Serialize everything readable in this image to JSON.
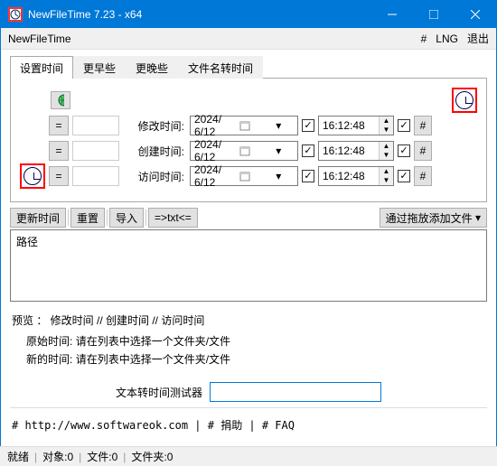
{
  "window": {
    "title": "NewFileTime 7.23 - x64"
  },
  "menubar": {
    "appname": "NewFileTime",
    "hash": "#",
    "lng": "LNG",
    "exit": "退出"
  },
  "tabs": {
    "settime": "设置时间",
    "earlier": "更早些",
    "later": "更晚些",
    "fromname": "文件名转时间"
  },
  "rows": {
    "eq": "=",
    "modify": "修改时间:",
    "create": "创建时间:",
    "access": "访问时间:",
    "date": "2024/ 6/12",
    "time": "16:12:48",
    "hash": "#"
  },
  "toolbar": {
    "update": "更新时间",
    "reset": "重置",
    "import": "导入",
    "txt": "=>txt<=",
    "drop": "通过拖放添加文件",
    "dropcaret": "▾"
  },
  "list": {
    "header": "路径"
  },
  "preview": {
    "line1": "预览 ：  修改时间    //    创建时间    //    访问时间",
    "orig_label": "原始时间:",
    "orig_val": "请在列表中选择一个文件夹/文件",
    "new_label": "新的时间:",
    "new_val": "请在列表中选择一个文件夹/文件"
  },
  "conv": {
    "label": "文本转时间测试器"
  },
  "links": {
    "text": "# http://www.softwareok.com |  # 捐助  |  # FAQ"
  },
  "status": {
    "ready": "就绪",
    "objs": "对象:0",
    "files": "文件:0",
    "folders": "文件夹:0",
    "sep": "|"
  }
}
